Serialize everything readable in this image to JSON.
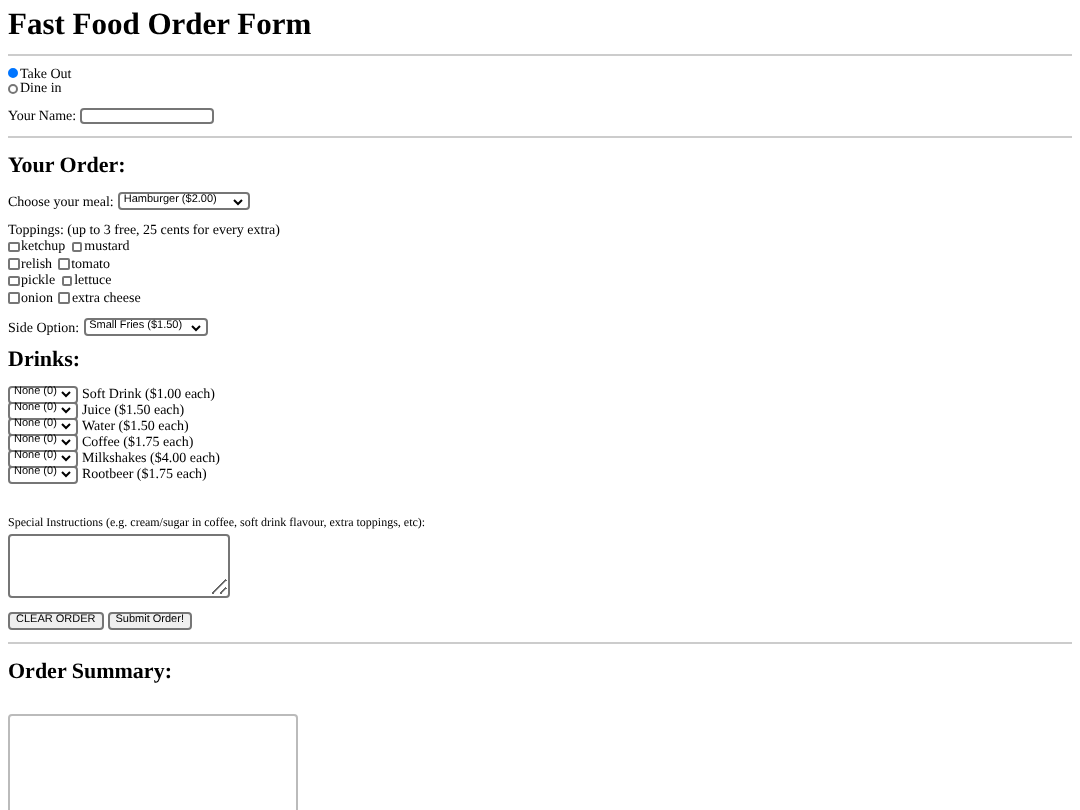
{
  "title": "Fast Food Order Form",
  "order_type": [
    {
      "label": "Take Out",
      "selected": true
    },
    {
      "label": "Dine in",
      "selected": false
    }
  ],
  "name_field": {
    "label": "Your Name:"
  },
  "order_heading": "Your Order:",
  "meal": {
    "label": "Choose your meal:",
    "value": "Hamburger ($2.00)"
  },
  "toppings_label": "Toppings: (up to 3 free, 25 cents for every extra)",
  "toppings": [
    {
      "label": "ketchup",
      "checked": false
    },
    {
      "label": "mustard",
      "checked": false
    },
    {
      "label": "relish",
      "checked": false
    },
    {
      "label": "tomato",
      "checked": false
    },
    {
      "label": "pickle",
      "checked": false
    },
    {
      "label": "lettuce",
      "checked": false
    },
    {
      "label": "onion",
      "checked": false
    },
    {
      "label": "extra cheese",
      "checked": false
    }
  ],
  "side": {
    "label": "Side Option:",
    "value": "Small Fries ($1.50)"
  },
  "drinks_heading": "Drinks:",
  "drinks": [
    {
      "quantity": "None (0)",
      "label": "Soft Drink ($1.00 each)"
    },
    {
      "quantity": "None (0)",
      "label": "Juice ($1.50 each)"
    },
    {
      "quantity": "None (0)",
      "label": "Water ($1.50 each)"
    },
    {
      "quantity": "None (0)",
      "label": "Coffee ($1.75 each)"
    },
    {
      "quantity": "None (0)",
      "label": "Milkshakes ($4.00 each)"
    },
    {
      "quantity": "None (0)",
      "label": "Rootbeer ($1.75 each)"
    }
  ],
  "special_instructions": {
    "label": "Special Instructions (e.g. cream/sugar in coffee, soft drink flavour, extra toppings, etc):"
  },
  "buttons": [
    "CLEAR ORDER",
    "Submit Order!"
  ],
  "summary_heading": "Order Summary:"
}
